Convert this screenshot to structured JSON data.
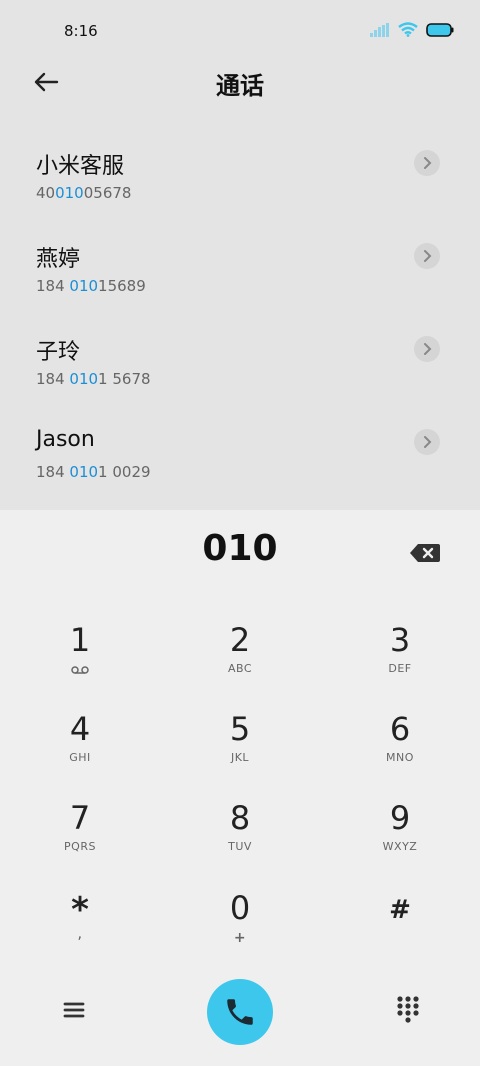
{
  "status_bar": {
    "time": "8:16"
  },
  "header": {
    "title": "通话"
  },
  "contacts": [
    {
      "name": "小米客服",
      "number_pre": "40",
      "number_match": "010",
      "number_post": "05678"
    },
    {
      "name": "燕婷",
      "number_pre": "184 ",
      "number_match": "010",
      "number_post": "15689"
    },
    {
      "name": "子玲",
      "number_pre": "184 ",
      "number_match": "010",
      "number_post": "1 5678"
    },
    {
      "name": "Jason",
      "number_pre": "184 ",
      "number_match": "010",
      "number_post": "1 0029"
    }
  ],
  "dialpad": {
    "entered": "010",
    "keys": [
      {
        "digit": "1",
        "letters": ""
      },
      {
        "digit": "2",
        "letters": "ABC"
      },
      {
        "digit": "3",
        "letters": "DEF"
      },
      {
        "digit": "4",
        "letters": "GHI"
      },
      {
        "digit": "5",
        "letters": "JKL"
      },
      {
        "digit": "6",
        "letters": "MNO"
      },
      {
        "digit": "7",
        "letters": "PQRS"
      },
      {
        "digit": "8",
        "letters": "TUV"
      },
      {
        "digit": "9",
        "letters": "WXYZ"
      },
      {
        "digit": "*",
        "letters": ","
      },
      {
        "digit": "0",
        "letters": "+"
      },
      {
        "digit": "#",
        "letters": ""
      }
    ]
  },
  "icons": {
    "signal": "signal-icon",
    "wifi": "wifi-icon",
    "battery": "battery-icon",
    "back": "back-arrow-icon",
    "chevron": "chevron-right-icon",
    "backspace": "backspace-icon",
    "voicemail": "voicemail-icon",
    "menu": "menu-icon",
    "call": "phone-icon",
    "keypad": "keypad-icon"
  },
  "colors": {
    "accent": "#1b8fd6",
    "call_button": "#3ec7ec",
    "battery": "#3ec7ec"
  }
}
